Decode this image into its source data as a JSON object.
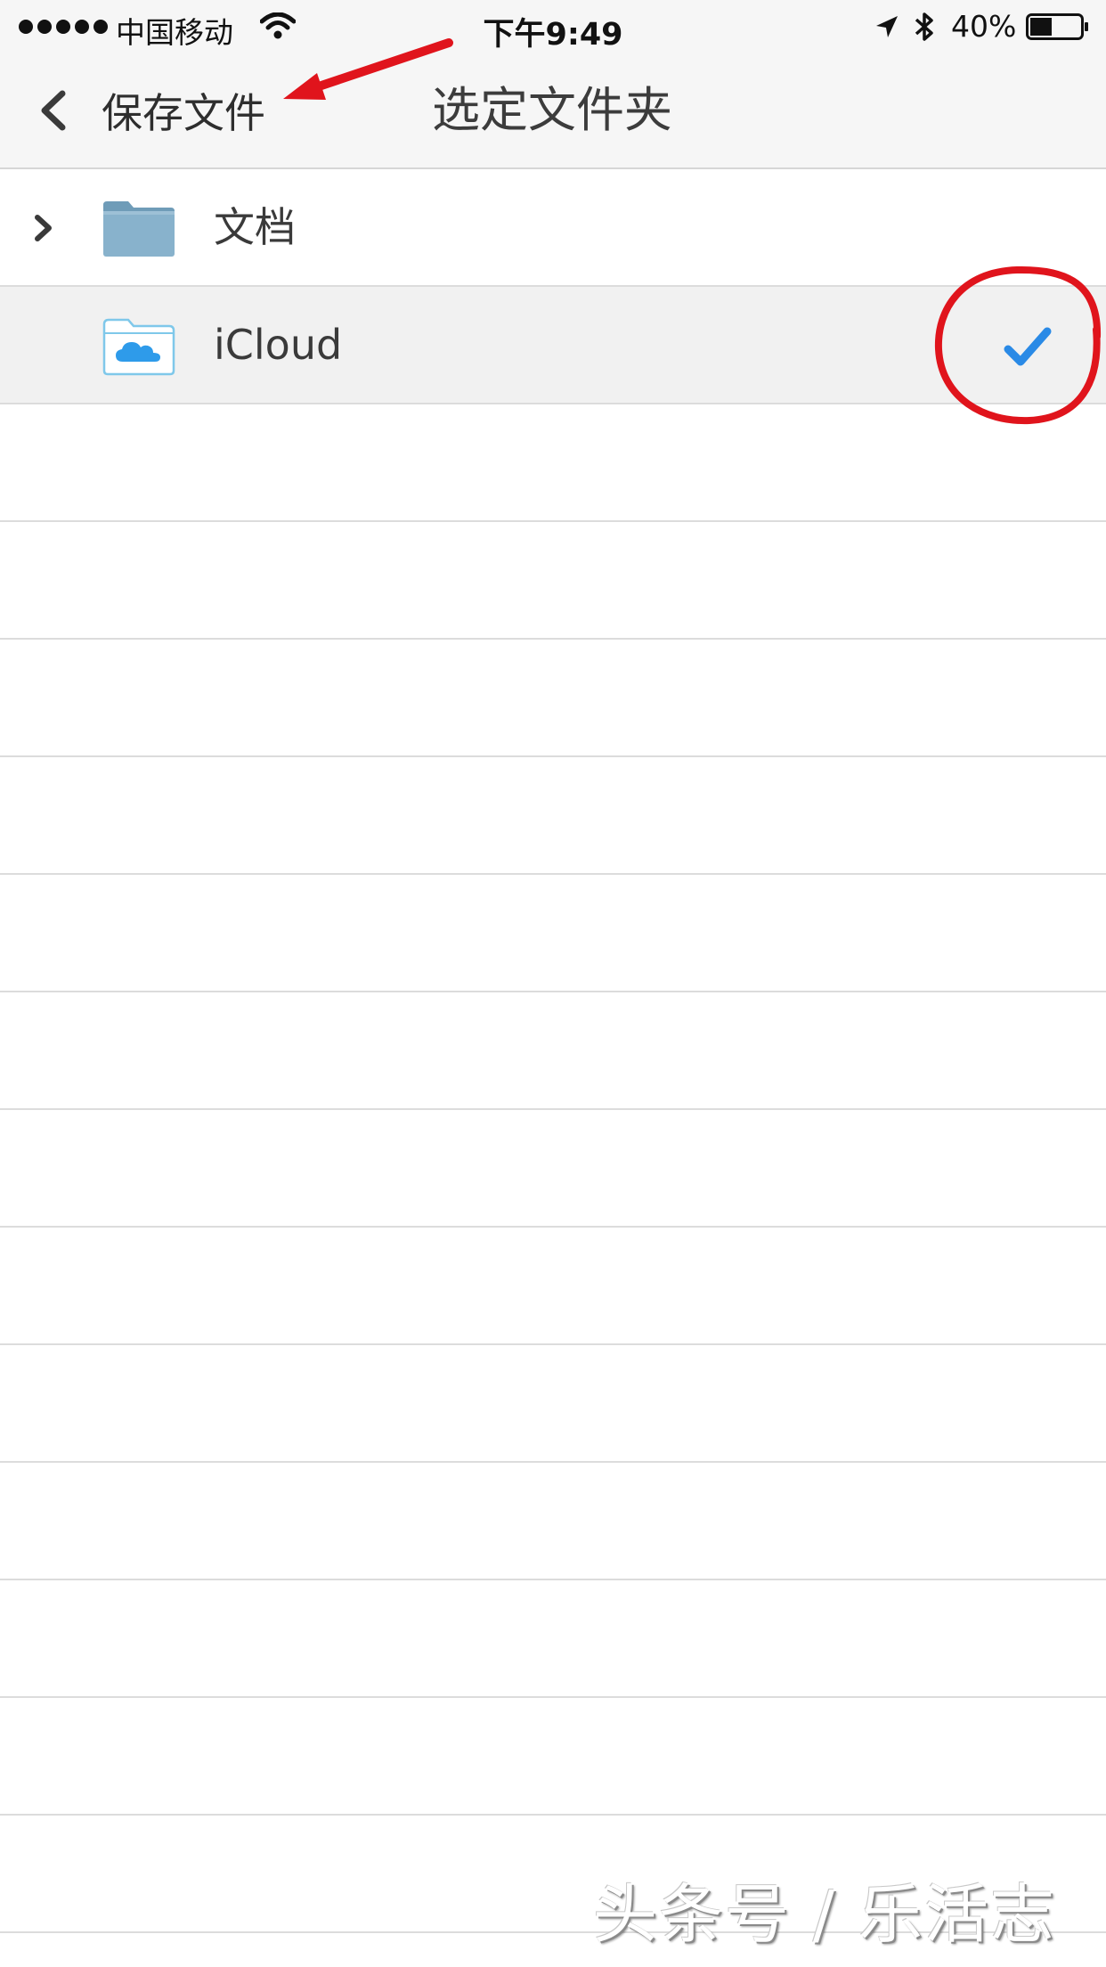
{
  "status_bar": {
    "carrier": "中国移动",
    "time": "下午9:49",
    "battery": "40%",
    "icons": [
      "signal-dots-icon",
      "wifi-icon",
      "location-arrow-icon",
      "bluetooth-icon",
      "battery-icon"
    ]
  },
  "nav": {
    "back_label": "保存文件",
    "title": "选定文件夹"
  },
  "folders": [
    {
      "label": "文档",
      "icon": "folder-icon",
      "expandable": true,
      "selected": false
    },
    {
      "label": "iCloud",
      "icon": "icloud-folder-icon",
      "expandable": false,
      "selected": true
    }
  ],
  "annotations": {
    "arrow_color": "#e0141c",
    "circle_color": "#e0141c"
  },
  "colors": {
    "checkmark": "#2a8ae6",
    "folder": "#88b2cc",
    "header_bg": "#f6f6f6"
  },
  "watermark": "头条号 / 乐活志"
}
